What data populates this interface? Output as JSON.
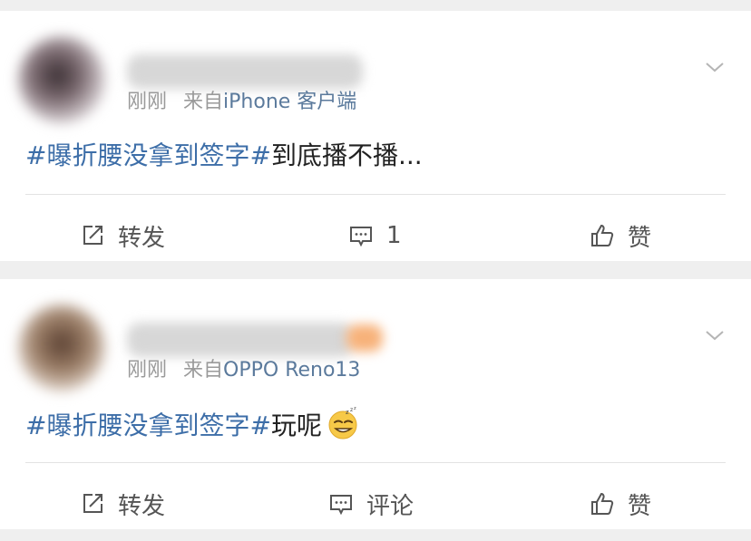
{
  "posts": [
    {
      "time": "刚刚",
      "source_prefix": "来自",
      "source": "iPhone 客户端",
      "hashtag": "#曝折腰没拿到签字#",
      "text": "到底播不播...",
      "has_emoji": false,
      "actions": {
        "repost": "转发",
        "comment": "1",
        "like": "赞"
      }
    },
    {
      "time": "刚刚",
      "source_prefix": "来自",
      "source": "OPPO Reno13",
      "hashtag": "#曝折腰没拿到签字#",
      "text": "玩呢",
      "has_emoji": true,
      "emoji": "sleepy-grin-emoji",
      "actions": {
        "repost": "转发",
        "comment": "评论",
        "like": "赞"
      }
    }
  ],
  "icons": [
    "repost-icon",
    "comment-icon",
    "like-icon",
    "chevron-down-icon"
  ],
  "colors": {
    "link": "#3d6ea8",
    "meta": "#9a9a9a",
    "source": "#5b7a9c",
    "bg": "#efefef"
  }
}
